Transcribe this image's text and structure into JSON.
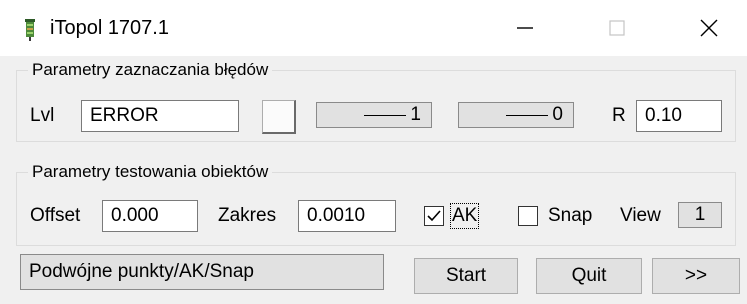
{
  "window": {
    "title": "iTopol 1707.1",
    "icon": "app-icon",
    "minimize_glyph": "—",
    "close_glyph": "✕"
  },
  "group1": {
    "title": "Parametry zaznaczania błędów",
    "lvl_label": "Lvl",
    "lvl_value": "ERROR",
    "line_width_1": "1",
    "line_width_2": "0",
    "r_label": "R",
    "r_value": "0.10"
  },
  "group2": {
    "title": "Parametry testowania obiektów",
    "offset_label": "Offset",
    "offset_value": "0.000",
    "zakres_label": "Zakres",
    "zakres_value": "0.0010",
    "ak_label": "AK",
    "ak_checked": true,
    "snap_label": "Snap",
    "snap_checked": false,
    "view_label": "View",
    "view_value": "1"
  },
  "footer": {
    "status": "Podwójne punkty/AK/Snap",
    "start_label": "Start",
    "quit_label": "Quit",
    "more_label": ">>"
  }
}
